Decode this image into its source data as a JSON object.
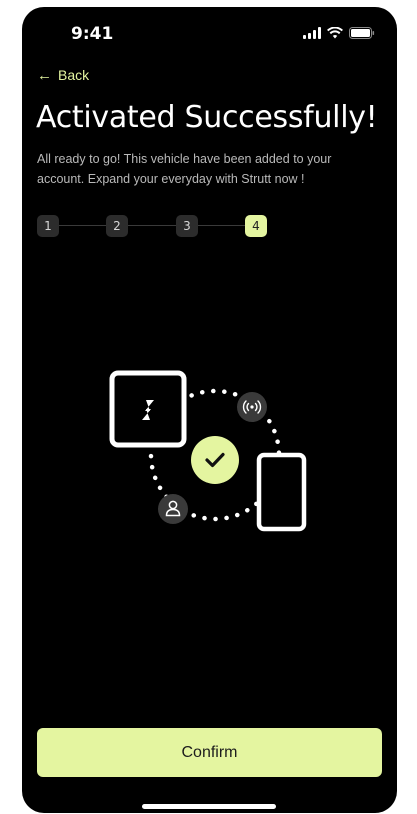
{
  "status_bar": {
    "time": "9:41"
  },
  "header": {
    "back_label": "Back",
    "back_icon": "arrow-left-icon",
    "title": "Activated Successfully!",
    "subtitle": "All ready to go! This vehicle have been added to your account. Expand your everyday with Strutt now !"
  },
  "steps": {
    "items": [
      "1",
      "2",
      "3",
      "4"
    ],
    "active_index": 3
  },
  "illustration": {
    "icons": [
      "vehicle-logo-icon",
      "wireless-signal-icon",
      "checkmark-icon",
      "user-icon",
      "phone-icon"
    ]
  },
  "footer": {
    "confirm_label": "Confirm"
  },
  "colors": {
    "background": "#000000",
    "accent": "#e4f5a0",
    "step_inactive": "#2c2c2c",
    "badge": "#3a3a3a"
  }
}
